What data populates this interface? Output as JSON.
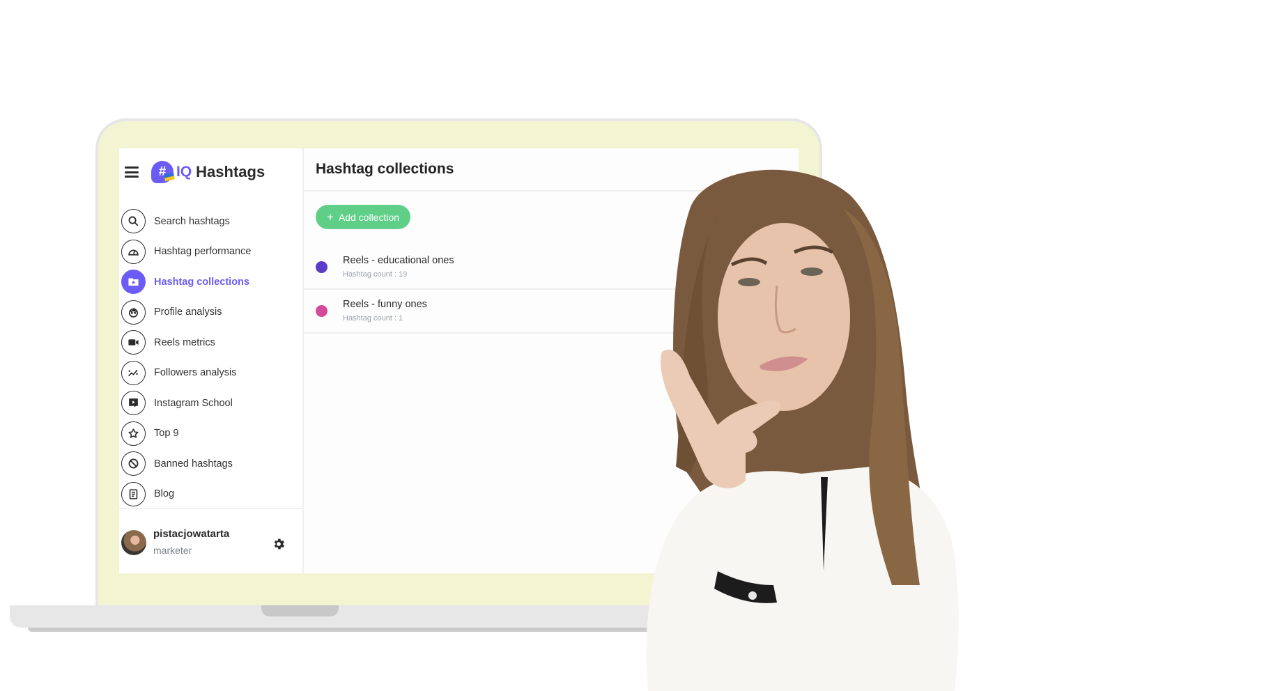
{
  "app": {
    "brand_iq": "IQ",
    "brand_name": "Hashtags",
    "brand_color": "#6b5cf5"
  },
  "sidebar": {
    "items": [
      {
        "label": "Search hashtags",
        "icon": "search-icon",
        "active": false
      },
      {
        "label": "Hashtag performance",
        "icon": "speedometer-icon",
        "active": false
      },
      {
        "label": "Hashtag collections",
        "icon": "folder-star-icon",
        "active": true
      },
      {
        "label": "Profile analysis",
        "icon": "face-icon",
        "active": false
      },
      {
        "label": "Reels metrics",
        "icon": "video-camera-icon",
        "active": false
      },
      {
        "label": "Followers analysis",
        "icon": "trend-chart-icon",
        "active": false
      },
      {
        "label": "Instagram School",
        "icon": "play-message-icon",
        "active": false
      },
      {
        "label": "Top 9",
        "icon": "star-icon",
        "active": false
      },
      {
        "label": "Banned hashtags",
        "icon": "ban-icon",
        "active": false
      },
      {
        "label": "Blog",
        "icon": "document-icon",
        "active": false
      }
    ],
    "user": {
      "name": "pistacjowatarta",
      "role": "marketer"
    }
  },
  "main": {
    "title": "Hashtag collections",
    "add_button_label": "Add collection",
    "collections": [
      {
        "name": "Reels - educational ones",
        "count_text": "Hashtag count : 19",
        "color": "#5a3cc8"
      },
      {
        "name": "Reels - funny ones",
        "count_text": "Hashtag count : 1",
        "color": "#d44a9a"
      }
    ]
  },
  "colors": {
    "accent": "#6b5cf5",
    "add_button": "#5fcf88",
    "laptop_frame": "#f3f5d2"
  }
}
